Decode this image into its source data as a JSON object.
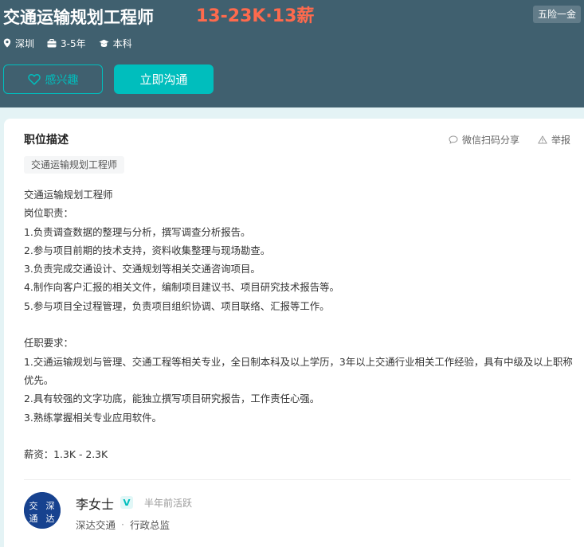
{
  "job": {
    "title": "交通运输规划工程师",
    "salary": "13-23K·13薪",
    "welfare": "五险一金",
    "location": "深圳",
    "experience": "3-5年",
    "degree": "本科"
  },
  "actions": {
    "interest_label": "感兴趣",
    "chat_label": "立即沟通"
  },
  "section": {
    "title": "职位描述",
    "share_label": "微信扫码分享",
    "report_label": "举报",
    "keyword_tag": "交通运输规划工程师"
  },
  "description": {
    "lines": [
      "交通运输规划工程师",
      "岗位职责：",
      "1.负责调查数据的整理与分析，撰写调查分析报告。",
      "2.参与项目前期的技术支持，资料收集整理与现场勘查。",
      "3.负责完成交通设计、交通规划等相关交通咨询项目。",
      "4.制作向客户汇报的相关文件，编制项目建议书、项目研究技术报告等。",
      "5.参与项目全过程管理，负责项目组织协调、项目联络、汇报等工作。",
      "",
      "任职要求：",
      "1.交通运输规划与管理、交通工程等相关专业，全日制本科及以上学历，3年以上交通行业相关工作经验，具有中级及以上职称优先。",
      "2.具有较强的文字功底，能独立撰写项目研究报告，工作责任心强。",
      "3.熟练掌握相关专业应用软件。",
      "",
      "薪资：1.3K - 2.3K"
    ]
  },
  "recruiter": {
    "name": "李女士",
    "active": "半年前活跃",
    "company": "深达交通",
    "position": "行政总监",
    "separator": "·",
    "avatar_text": "交 深 通 达"
  },
  "colors": {
    "header_bg": "#40606f",
    "accent": "#00bebd",
    "salary": "#fe6a4d",
    "page_bg": "#e4f3f5"
  },
  "icons": {
    "location": "location-pin-icon",
    "experience": "briefcase-icon",
    "degree": "graduation-cap-icon",
    "interest": "heart-outline-icon",
    "share": "chat-bubble-icon",
    "report": "warning-triangle-icon",
    "verified": "verified-v-icon"
  }
}
